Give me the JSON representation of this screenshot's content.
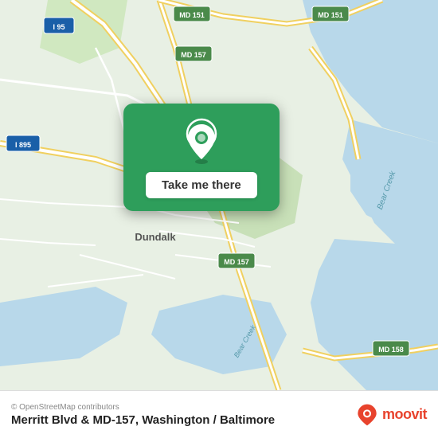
{
  "map": {
    "alt": "Map of Merritt Blvd and MD-157 area, Baltimore/Washington",
    "center_label": "Dundalk"
  },
  "button": {
    "label": "Take me there"
  },
  "bottom_bar": {
    "osm_credit": "© OpenStreetMap contributors",
    "location_title": "Merritt Blvd & MD-157, Washington / Baltimore",
    "moovit_label": "moovit"
  },
  "road_labels": [
    "I 95",
    "I 895",
    "MD 151",
    "MD 157",
    "MD 157",
    "MD 151",
    "MD 158"
  ],
  "colors": {
    "map_bg": "#e8f0e4",
    "water": "#b8d8e8",
    "road_yellow": "#f0d060",
    "road_white": "#ffffff",
    "green_card": "#2e9e5b",
    "moovit_red": "#e8432d"
  }
}
